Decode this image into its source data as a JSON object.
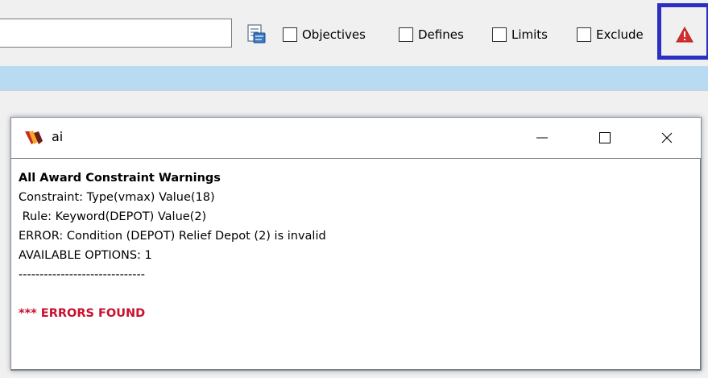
{
  "toolbar": {
    "search": {
      "value": "",
      "placeholder": ""
    },
    "document_icon": "document-icon",
    "checkboxes": [
      {
        "label": "Objectives",
        "checked": false
      },
      {
        "label": "Defines",
        "checked": false
      },
      {
        "label": "Limits",
        "checked": false
      },
      {
        "label": "Exclude",
        "checked": false
      }
    ],
    "warning_icon": "warning-triangle-icon",
    "warning_color": "#d32f2f",
    "highlight_color": "#2b2fc2"
  },
  "band_color": "#b9dbf2",
  "popup": {
    "title": "ai",
    "app_icon": "app-logo-icon",
    "controls": {
      "minimize": "minimize-icon",
      "maximize": "maximize-icon",
      "close": "close-icon"
    },
    "lines": {
      "heading": "All Award Constraint Warnings",
      "constraint": "Constraint: Type(vmax) Value(18)",
      "rule": " Rule: Keyword(DEPOT) Value(2)",
      "error": "ERROR: Condition (DEPOT) Relief Depot (2) is invalid",
      "options": "AVAILABLE OPTIONS: 1",
      "separator": "------------------------------",
      "blank": "",
      "errors_found": "*** ERRORS FOUND"
    },
    "error_color": "#c8102e"
  }
}
